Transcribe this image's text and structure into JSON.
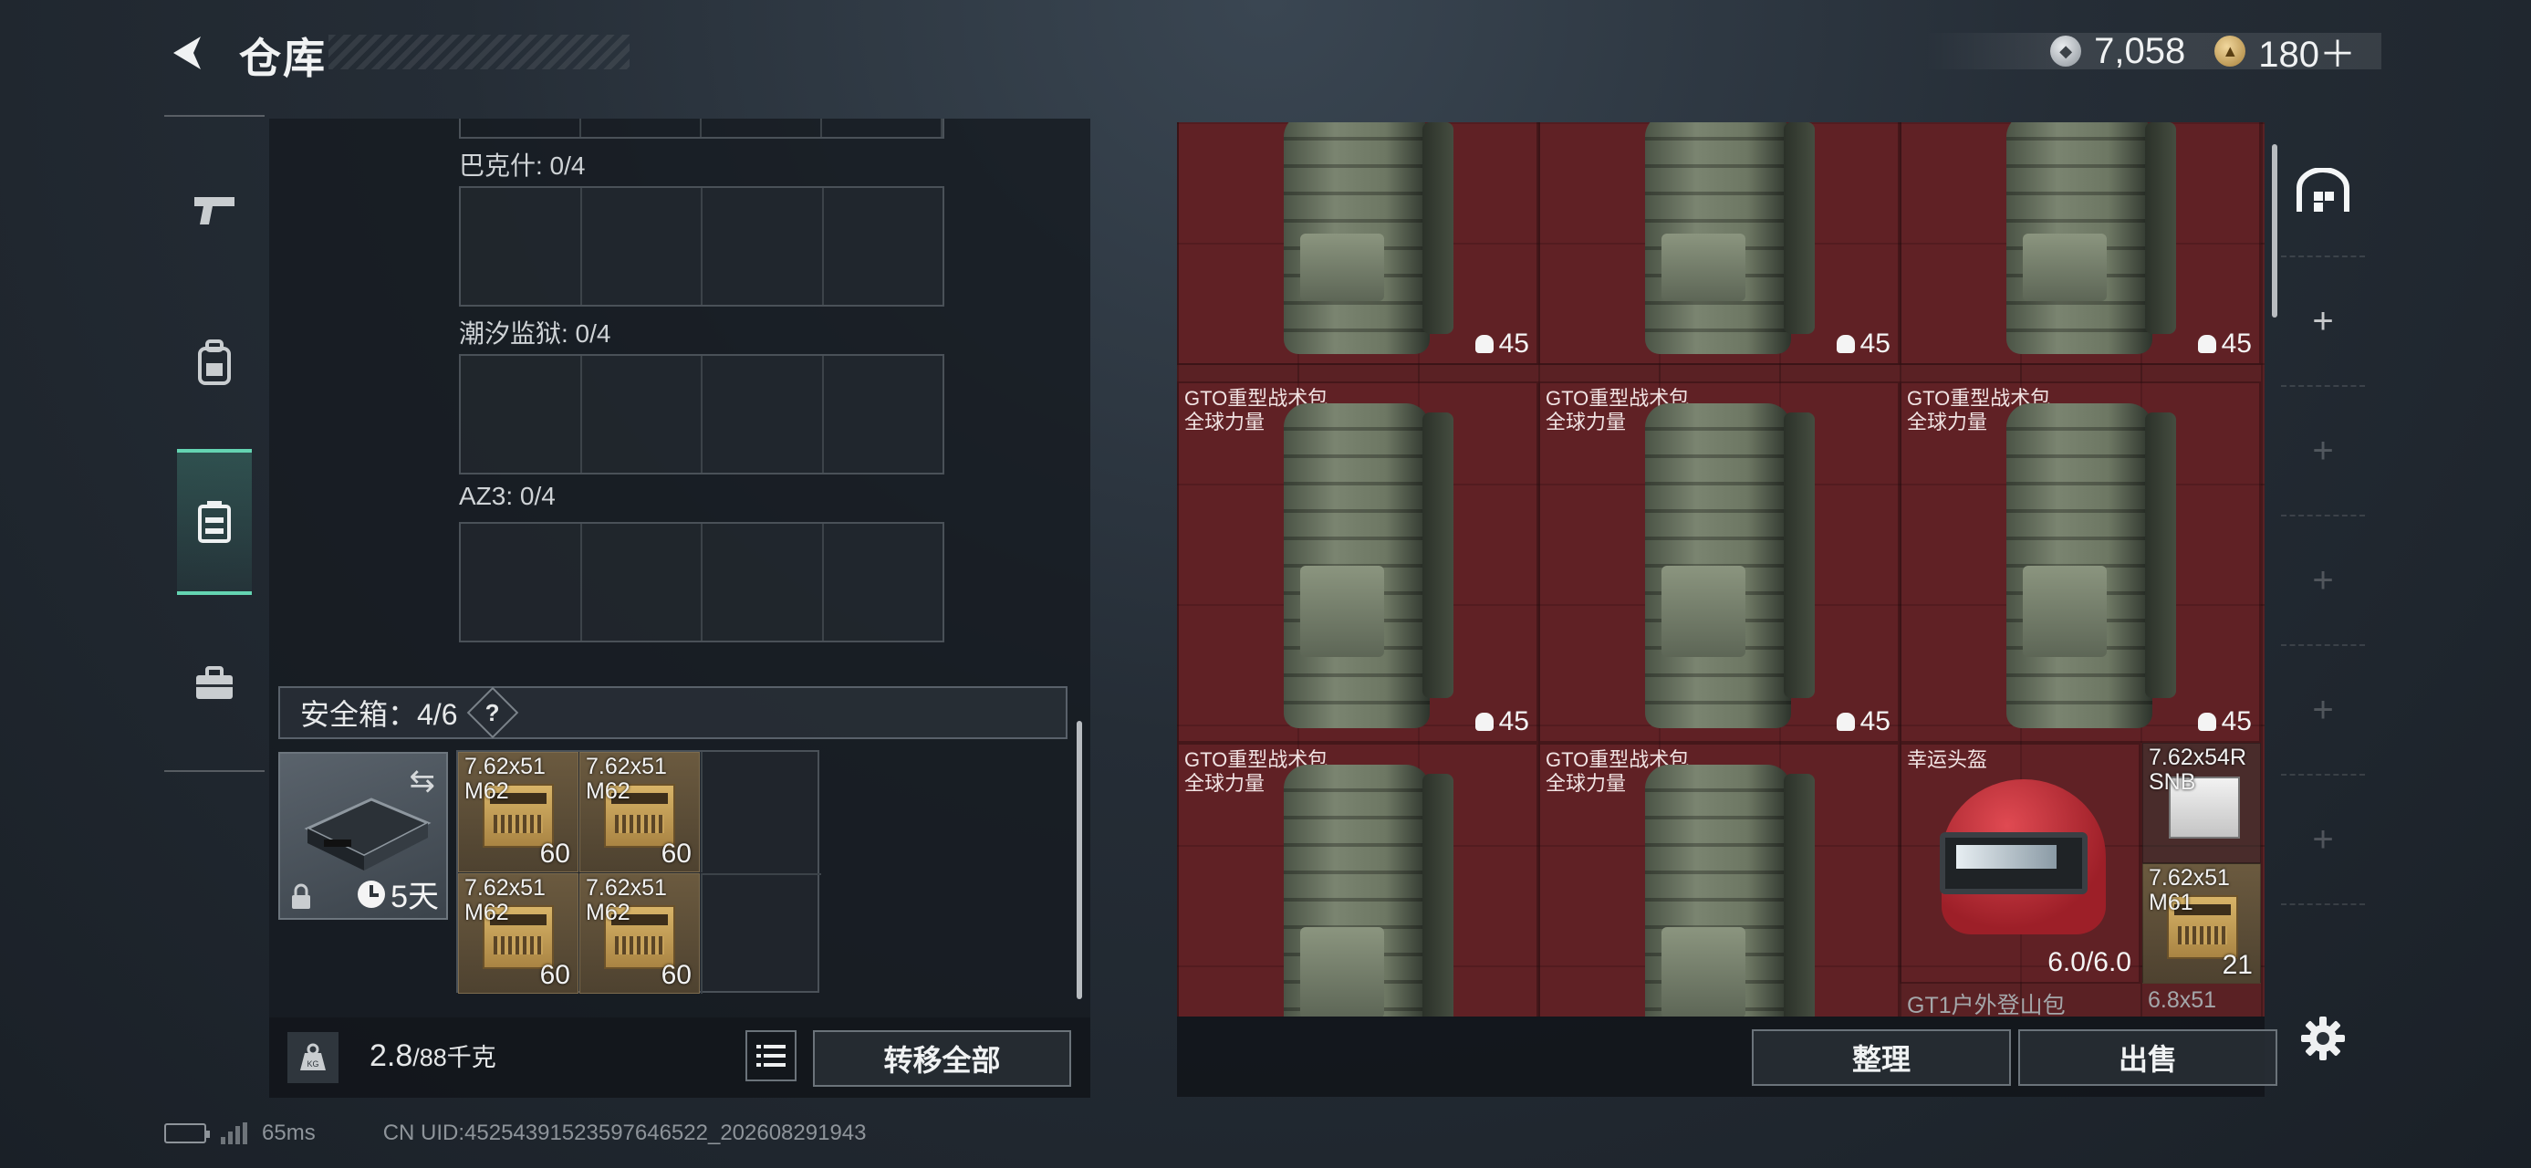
{
  "header": {
    "title": "仓库",
    "currency": [
      {
        "icon": "silver-coin-icon",
        "value": "7,058"
      },
      {
        "icon": "gold-coin-icon",
        "value": "180＋"
      }
    ]
  },
  "rail": {
    "items": [
      {
        "icon": "pistol-icon",
        "active": false
      },
      {
        "icon": "backpack-icon",
        "active": false
      },
      {
        "icon": "container-icon",
        "active": true
      },
      {
        "icon": "briefcase-icon",
        "active": false
      }
    ]
  },
  "containers": [
    {
      "label": "巴克什: 0/4"
    },
    {
      "label": "潮汐监狱: 0/4"
    },
    {
      "label": "AZ3: 0/4"
    }
  ],
  "safe_box": {
    "label": "安全箱：4/6",
    "help": "?",
    "timer": "5天",
    "items": [
      {
        "name": "7.62x51\nM62",
        "count": "60"
      },
      {
        "name": "7.62x51\nM62",
        "count": "60"
      },
      {
        "name": "7.62x51\nM62",
        "count": "60"
      },
      {
        "name": "7.62x51\nM62",
        "count": "60"
      }
    ]
  },
  "weight": {
    "current": "2.8",
    "max": "/88千克"
  },
  "buttons": {
    "transfer_all": "转移全部",
    "sort": "整理",
    "sell": "出售"
  },
  "stash": {
    "backpack_name": "GTO重型战术包\n全球力量",
    "backpack_count": "45",
    "helmet": {
      "name": "幸运头盔",
      "durability": "6.0/6.0"
    },
    "small_items": [
      {
        "name": "7.62x54R\nSNB",
        "count": ""
      },
      {
        "name": "7.62x51\nM61",
        "count": "21"
      }
    ],
    "partial_labels": [
      "GT1户外登山包",
      "6.8x51"
    ]
  },
  "status": {
    "ping": "65ms",
    "uid": "CN UID:4525439152359764652​2_202608291943"
  }
}
